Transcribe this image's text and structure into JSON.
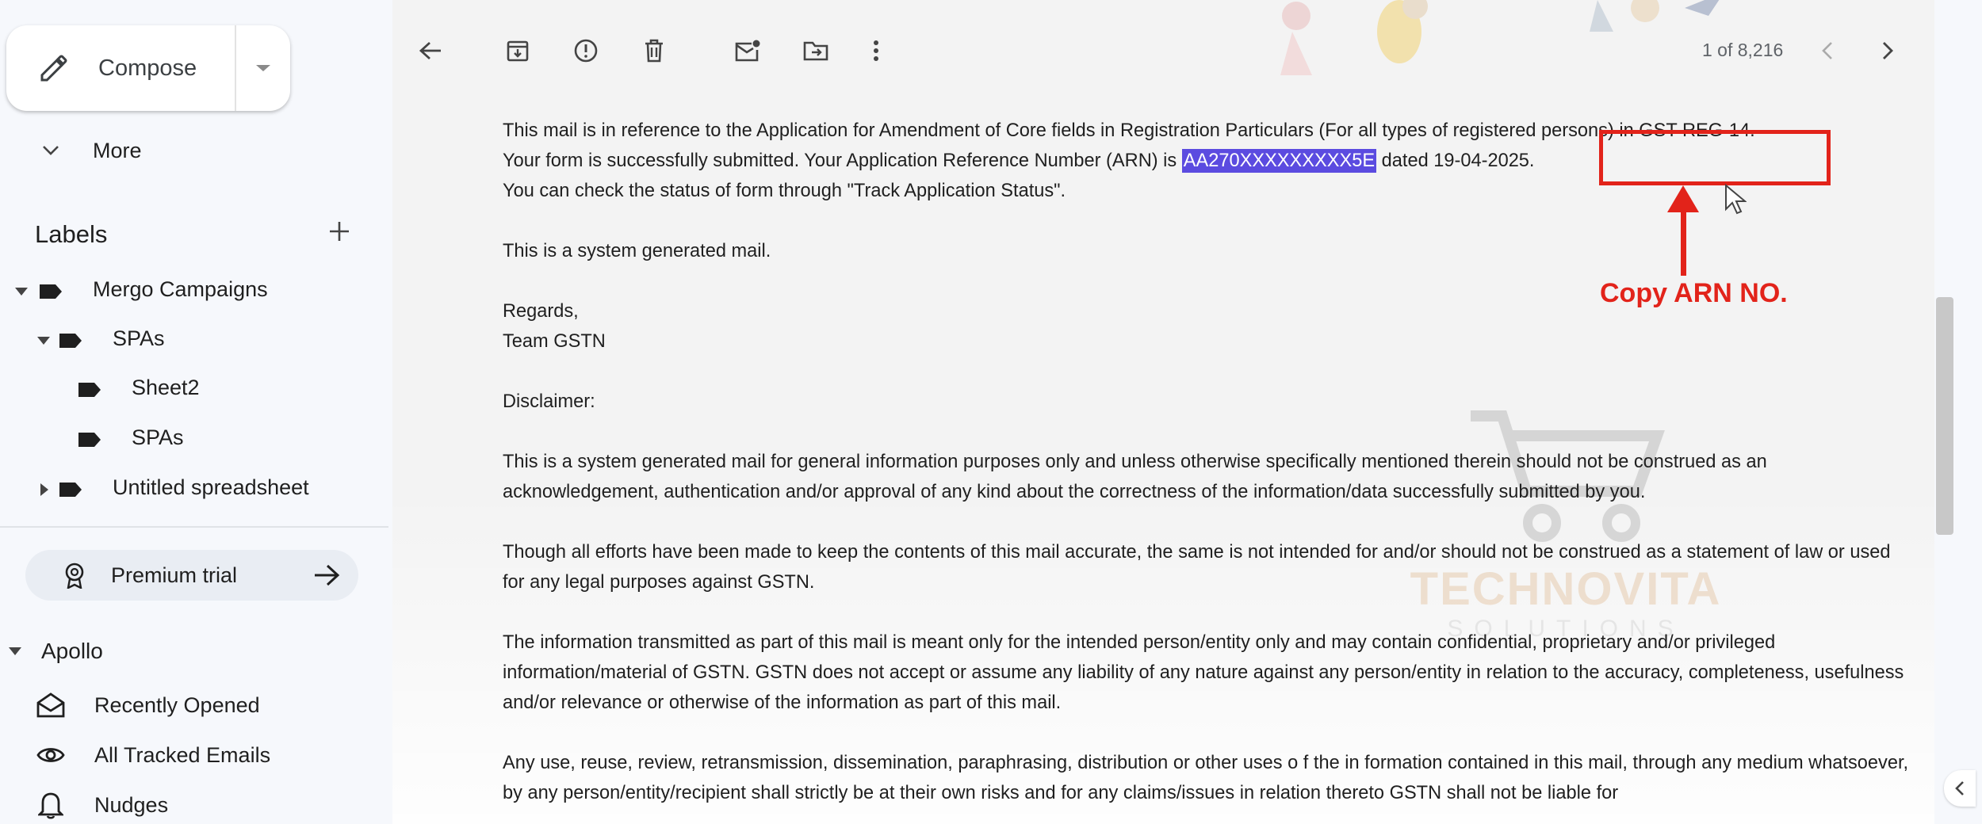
{
  "sidebar": {
    "compose_label": "Compose",
    "more_label": "More",
    "labels_heading": "Labels",
    "labels": [
      {
        "label": "Mergo Campaigns"
      },
      {
        "label": "SPAs"
      },
      {
        "label": "Sheet2"
      },
      {
        "label": "SPAs"
      },
      {
        "label": "Untitled spreadsheet"
      }
    ],
    "premium_label": "Premium trial",
    "apollo_heading": "Apollo",
    "apollo_items": [
      {
        "label": "Recently Opened",
        "icon": "envelope-open-icon"
      },
      {
        "label": "All Tracked Emails",
        "icon": "eye-icon"
      },
      {
        "label": "Nudges",
        "icon": "bell-icon"
      }
    ]
  },
  "toolbar": {
    "pager": "1 of 8,216",
    "icons": [
      "back-arrow-icon",
      "archive-icon",
      "report-spam-icon",
      "delete-icon",
      "mark-unread-icon",
      "move-to-icon",
      "more-options-icon",
      "prev-icon",
      "next-icon"
    ]
  },
  "email": {
    "p1_line1": "This mail is in reference to the Application for Amendment of Core fields in Registration Particulars (For all types of registered persons) in GST REG-14.",
    "p1_line2_pre": "Your form is successfully submitted. Your Application Reference Number (ARN) is ",
    "arn": "AA270XXXXXXXXX5E",
    "p1_line2_post": " dated 19-04-2025.",
    "p1_line3": "You can check the status of form through \"Track Application Status\".",
    "p2": "This is a system generated mail.",
    "p3_line1": "Regards,",
    "p3_line2": "Team GSTN",
    "p4": "Disclaimer:",
    "p5": "This is a system generated mail for general information purposes only and unless otherwise specifically mentioned therein should not be construed as an acknowledgement, authentication and/or approval of any kind about the correctness of the information/data successfully submitted by you.",
    "p6": "Though all efforts have been made to keep the contents of this mail accurate, the same is not intended for and/or should not be construed as a statement of law or used for any legal purposes against GSTN.",
    "p7": "The information transmitted as part of this mail is meant only for the intended person/entity only and may contain confidential, proprietary and/or privileged information/material of GSTN. GSTN does not accept or assume any liability of any nature against any person/entity in relation to the accuracy, completeness, usefulness and/or relevance or otherwise of the information as part of this mail.",
    "p8": "Any use, reuse, review, retransmission, dissemination, paraphrasing, distribution or other uses o  f the in  formation contained in this mail, through any medium whatsoever, by any person/entity/recipient shall strictly be at their own risks and for any claims/issues in relation thereto GSTN shall not be liable for"
  },
  "annotation": {
    "label": "Copy ARN NO.",
    "color": "#e2231a"
  },
  "watermark": {
    "title": "TECHNOVITA",
    "subtitle": "SOLUTIONS"
  }
}
